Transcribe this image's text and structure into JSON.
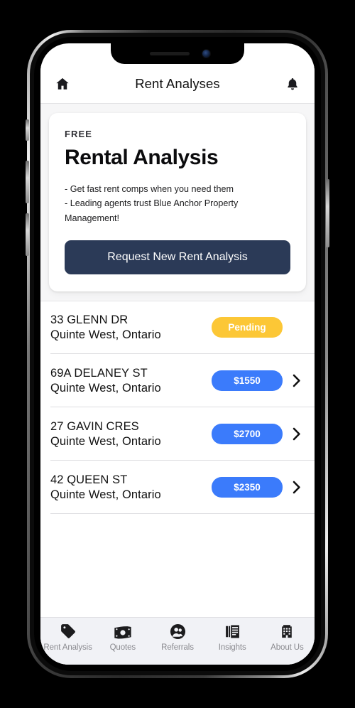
{
  "device": {
    "type": "smartphone-mockup",
    "notch": {
      "speaker": "speaker-grille",
      "camera": "front-camera"
    },
    "buttons": [
      "mute-switch",
      "volume-up",
      "volume-down",
      "power"
    ]
  },
  "header": {
    "title": "Rent Analyses",
    "left_icon": "home-icon",
    "right_icon": "bell-icon"
  },
  "promo": {
    "eyebrow": "FREE",
    "title": "Rental Analysis",
    "bullets": [
      "- Get fast rent comps when you need them",
      "- Leading agents trust Blue Anchor Property Management!"
    ],
    "cta_label": "Request New Rent Analysis",
    "cta_color": "#2b3a57"
  },
  "colors": {
    "pending_badge": "#fcc736",
    "price_badge": "#3b7bfb",
    "page_bg": "#f6f6f7",
    "tabbar_bg": "#f1f2f6"
  },
  "list": {
    "rows": [
      {
        "address": "33 GLENN DR",
        "location": "Quinte West, Ontario",
        "badge": "Pending",
        "badge_type": "pending",
        "chevron": false
      },
      {
        "address": "69A DELANEY ST",
        "location": "Quinte West, Ontario",
        "badge": "$1550",
        "badge_type": "price",
        "chevron": true
      },
      {
        "address": "27 GAVIN CRES",
        "location": "Quinte West, Ontario",
        "badge": "$2700",
        "badge_type": "price",
        "chevron": true
      },
      {
        "address": "42 QUEEN ST",
        "location": "Quinte West, Ontario",
        "badge": "$2350",
        "badge_type": "price",
        "chevron": true
      }
    ]
  },
  "tabbar": {
    "items": [
      {
        "label": "Rent Analysis",
        "icon": "tag-icon"
      },
      {
        "label": "Quotes",
        "icon": "money-icon"
      },
      {
        "label": "Referrals",
        "icon": "people-icon"
      },
      {
        "label": "Insights",
        "icon": "document-icon"
      },
      {
        "label": "About Us",
        "icon": "building-icon"
      }
    ]
  }
}
